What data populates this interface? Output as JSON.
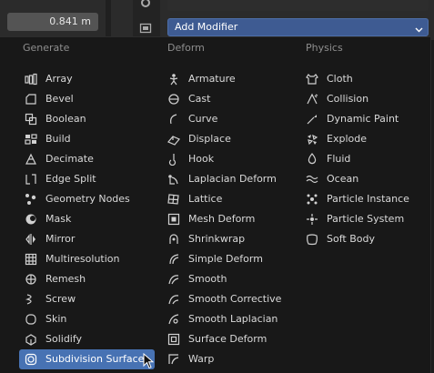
{
  "background": {
    "value_field": "0.841 m"
  },
  "add_modifier": {
    "label": "Add Modifier"
  },
  "menu": {
    "columns": [
      {
        "heading": "Generate",
        "items": [
          {
            "label": "Array",
            "icon": "array-icon"
          },
          {
            "label": "Bevel",
            "icon": "bevel-icon"
          },
          {
            "label": "Boolean",
            "icon": "boolean-icon"
          },
          {
            "label": "Build",
            "icon": "build-icon"
          },
          {
            "label": "Decimate",
            "icon": "decimate-icon"
          },
          {
            "label": "Edge Split",
            "icon": "edge-split-icon"
          },
          {
            "label": "Geometry Nodes",
            "icon": "geometry-nodes-icon"
          },
          {
            "label": "Mask",
            "icon": "mask-icon"
          },
          {
            "label": "Mirror",
            "icon": "mirror-icon"
          },
          {
            "label": "Multiresolution",
            "icon": "multiresolution-icon"
          },
          {
            "label": "Remesh",
            "icon": "remesh-icon"
          },
          {
            "label": "Screw",
            "icon": "screw-icon"
          },
          {
            "label": "Skin",
            "icon": "skin-icon"
          },
          {
            "label": "Solidify",
            "icon": "solidify-icon"
          },
          {
            "label": "Subdivision Surface",
            "icon": "subdivision-surface-icon",
            "active": true
          }
        ]
      },
      {
        "heading": "Deform",
        "items": [
          {
            "label": "Armature",
            "icon": "armature-icon"
          },
          {
            "label": "Cast",
            "icon": "cast-icon"
          },
          {
            "label": "Curve",
            "icon": "curve-icon"
          },
          {
            "label": "Displace",
            "icon": "displace-icon"
          },
          {
            "label": "Hook",
            "icon": "hook-icon"
          },
          {
            "label": "Laplacian Deform",
            "icon": "laplacian-deform-icon"
          },
          {
            "label": "Lattice",
            "icon": "lattice-icon"
          },
          {
            "label": "Mesh Deform",
            "icon": "mesh-deform-icon"
          },
          {
            "label": "Shrinkwrap",
            "icon": "shrinkwrap-icon"
          },
          {
            "label": "Simple Deform",
            "icon": "simple-deform-icon"
          },
          {
            "label": "Smooth",
            "icon": "smooth-icon"
          },
          {
            "label": "Smooth Corrective",
            "icon": "smooth-corrective-icon"
          },
          {
            "label": "Smooth Laplacian",
            "icon": "smooth-laplacian-icon"
          },
          {
            "label": "Surface Deform",
            "icon": "surface-deform-icon"
          },
          {
            "label": "Warp",
            "icon": "warp-icon"
          }
        ]
      },
      {
        "heading": "Physics",
        "items": [
          {
            "label": "Cloth",
            "icon": "cloth-icon"
          },
          {
            "label": "Collision",
            "icon": "collision-icon"
          },
          {
            "label": "Dynamic Paint",
            "icon": "dynamic-paint-icon"
          },
          {
            "label": "Explode",
            "icon": "explode-icon"
          },
          {
            "label": "Fluid",
            "icon": "fluid-icon"
          },
          {
            "label": "Ocean",
            "icon": "ocean-icon"
          },
          {
            "label": "Particle Instance",
            "icon": "particle-instance-icon"
          },
          {
            "label": "Particle System",
            "icon": "particle-system-icon"
          },
          {
            "label": "Soft Body",
            "icon": "soft-body-icon"
          }
        ]
      }
    ]
  },
  "colors": {
    "menu_bg": "#181818",
    "highlight": "#4772b3",
    "add_modifier_bg": "#3e5b92",
    "heading_text": "#8e8e8e",
    "item_text": "#d9d9d9"
  }
}
